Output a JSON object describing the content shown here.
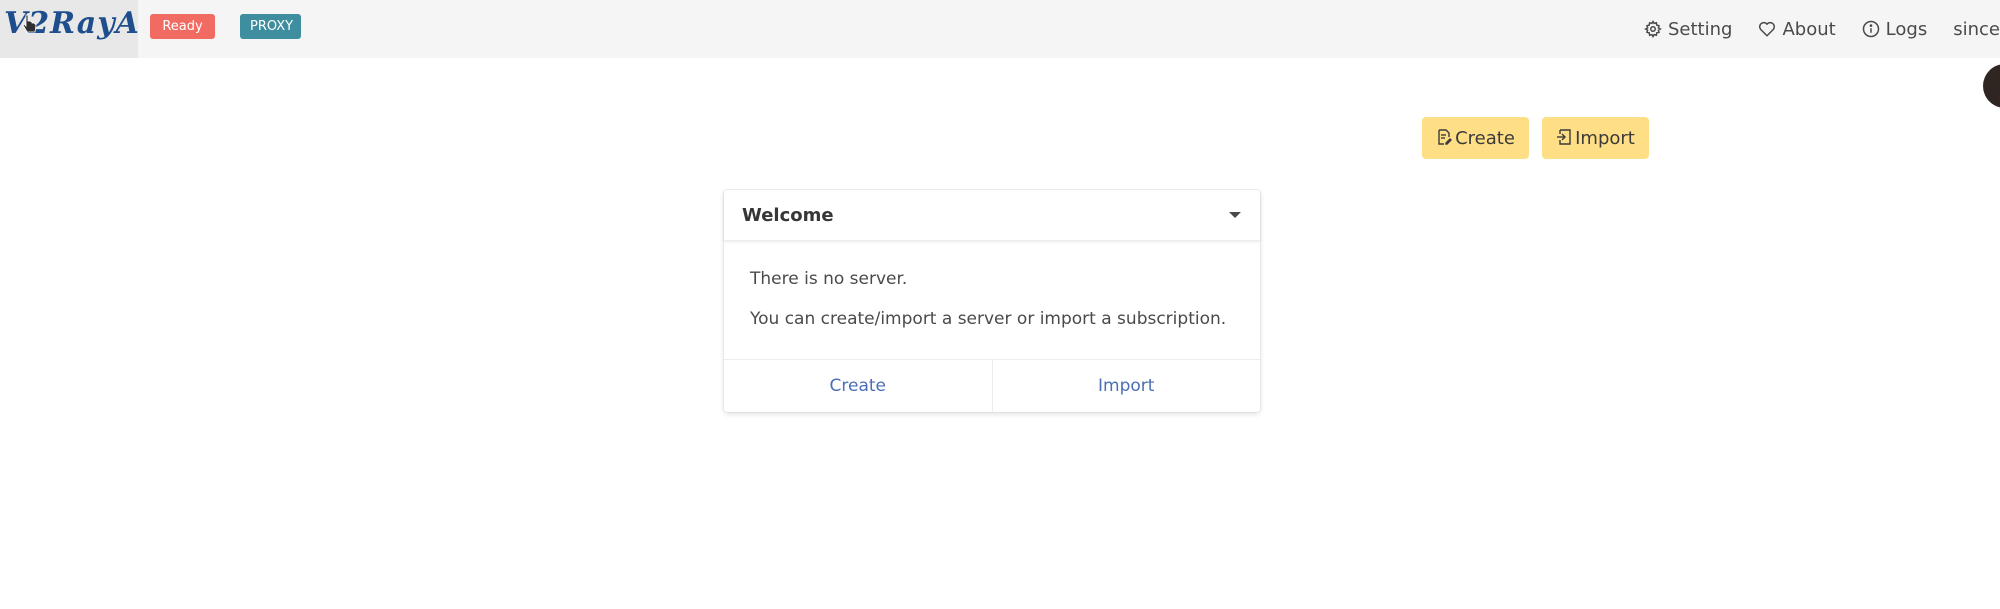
{
  "navbar": {
    "brand": "V2RayA",
    "tags": {
      "ready": "Ready",
      "proxy": "PROXY"
    },
    "menu": {
      "setting": "Setting",
      "about": "About",
      "logs": "Logs",
      "user": "since"
    }
  },
  "toolbar": {
    "create_label": "Create",
    "import_label": "Import"
  },
  "welcome_card": {
    "title": "Welcome",
    "line1": "There is no server.",
    "line2": "You can create/import a server or import a subscription.",
    "footer_create": "Create",
    "footer_import": "Import"
  },
  "colors": {
    "ready_tag": "#f26b63",
    "proxy_tag": "#3e8e9f",
    "toolbar_button": "#ffdf86",
    "link": "#4a6fb5"
  },
  "icons": {
    "setting": "gear-icon",
    "about": "heart-icon",
    "logs": "info-icon",
    "user": "caret-down-icon",
    "create": "file-edit-icon",
    "import": "import-icon",
    "card_toggle": "caret-down-icon"
  }
}
